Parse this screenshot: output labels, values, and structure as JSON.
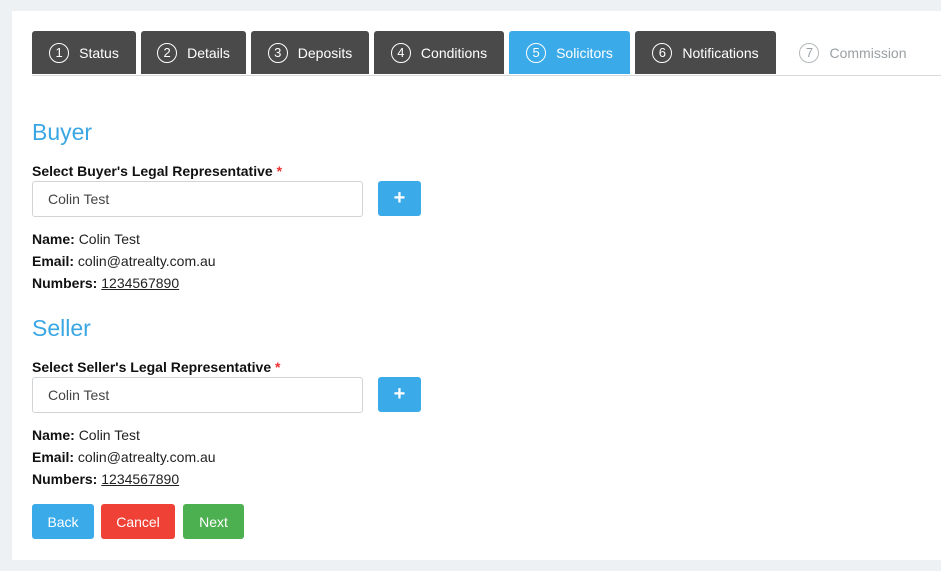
{
  "tabs": [
    {
      "num": "1",
      "label": "Status",
      "state": "done"
    },
    {
      "num": "2",
      "label": "Details",
      "state": "done"
    },
    {
      "num": "3",
      "label": "Deposits",
      "state": "done"
    },
    {
      "num": "4",
      "label": "Conditions",
      "state": "done"
    },
    {
      "num": "5",
      "label": "Solicitors",
      "state": "active"
    },
    {
      "num": "6",
      "label": "Notifications",
      "state": "done"
    },
    {
      "num": "7",
      "label": "Commission",
      "state": "disabled"
    }
  ],
  "buyer": {
    "title": "Buyer",
    "field_label": "Select Buyer's Legal Representative",
    "required_mark": "*",
    "selected": "Colin Test",
    "add_icon": "+",
    "name_label": "Name:",
    "name": "Colin Test",
    "email_label": "Email:",
    "email": "colin@atrealty.com.au",
    "numbers_label": "Numbers:",
    "numbers": "1234567890"
  },
  "seller": {
    "title": "Seller",
    "field_label": "Select Seller's Legal Representative",
    "required_mark": "*",
    "selected": "Colin Test",
    "add_icon": "+",
    "name_label": "Name:",
    "name": "Colin Test",
    "email_label": "Email:",
    "email": "colin@atrealty.com.au",
    "numbers_label": "Numbers:",
    "numbers": "1234567890"
  },
  "actions": {
    "back": "Back",
    "cancel": "Cancel",
    "next": "Next"
  },
  "colors": {
    "accent": "#3aaae8",
    "tab_dark": "#4a4a4a",
    "danger": "#ef4136",
    "success": "#4caf50"
  }
}
